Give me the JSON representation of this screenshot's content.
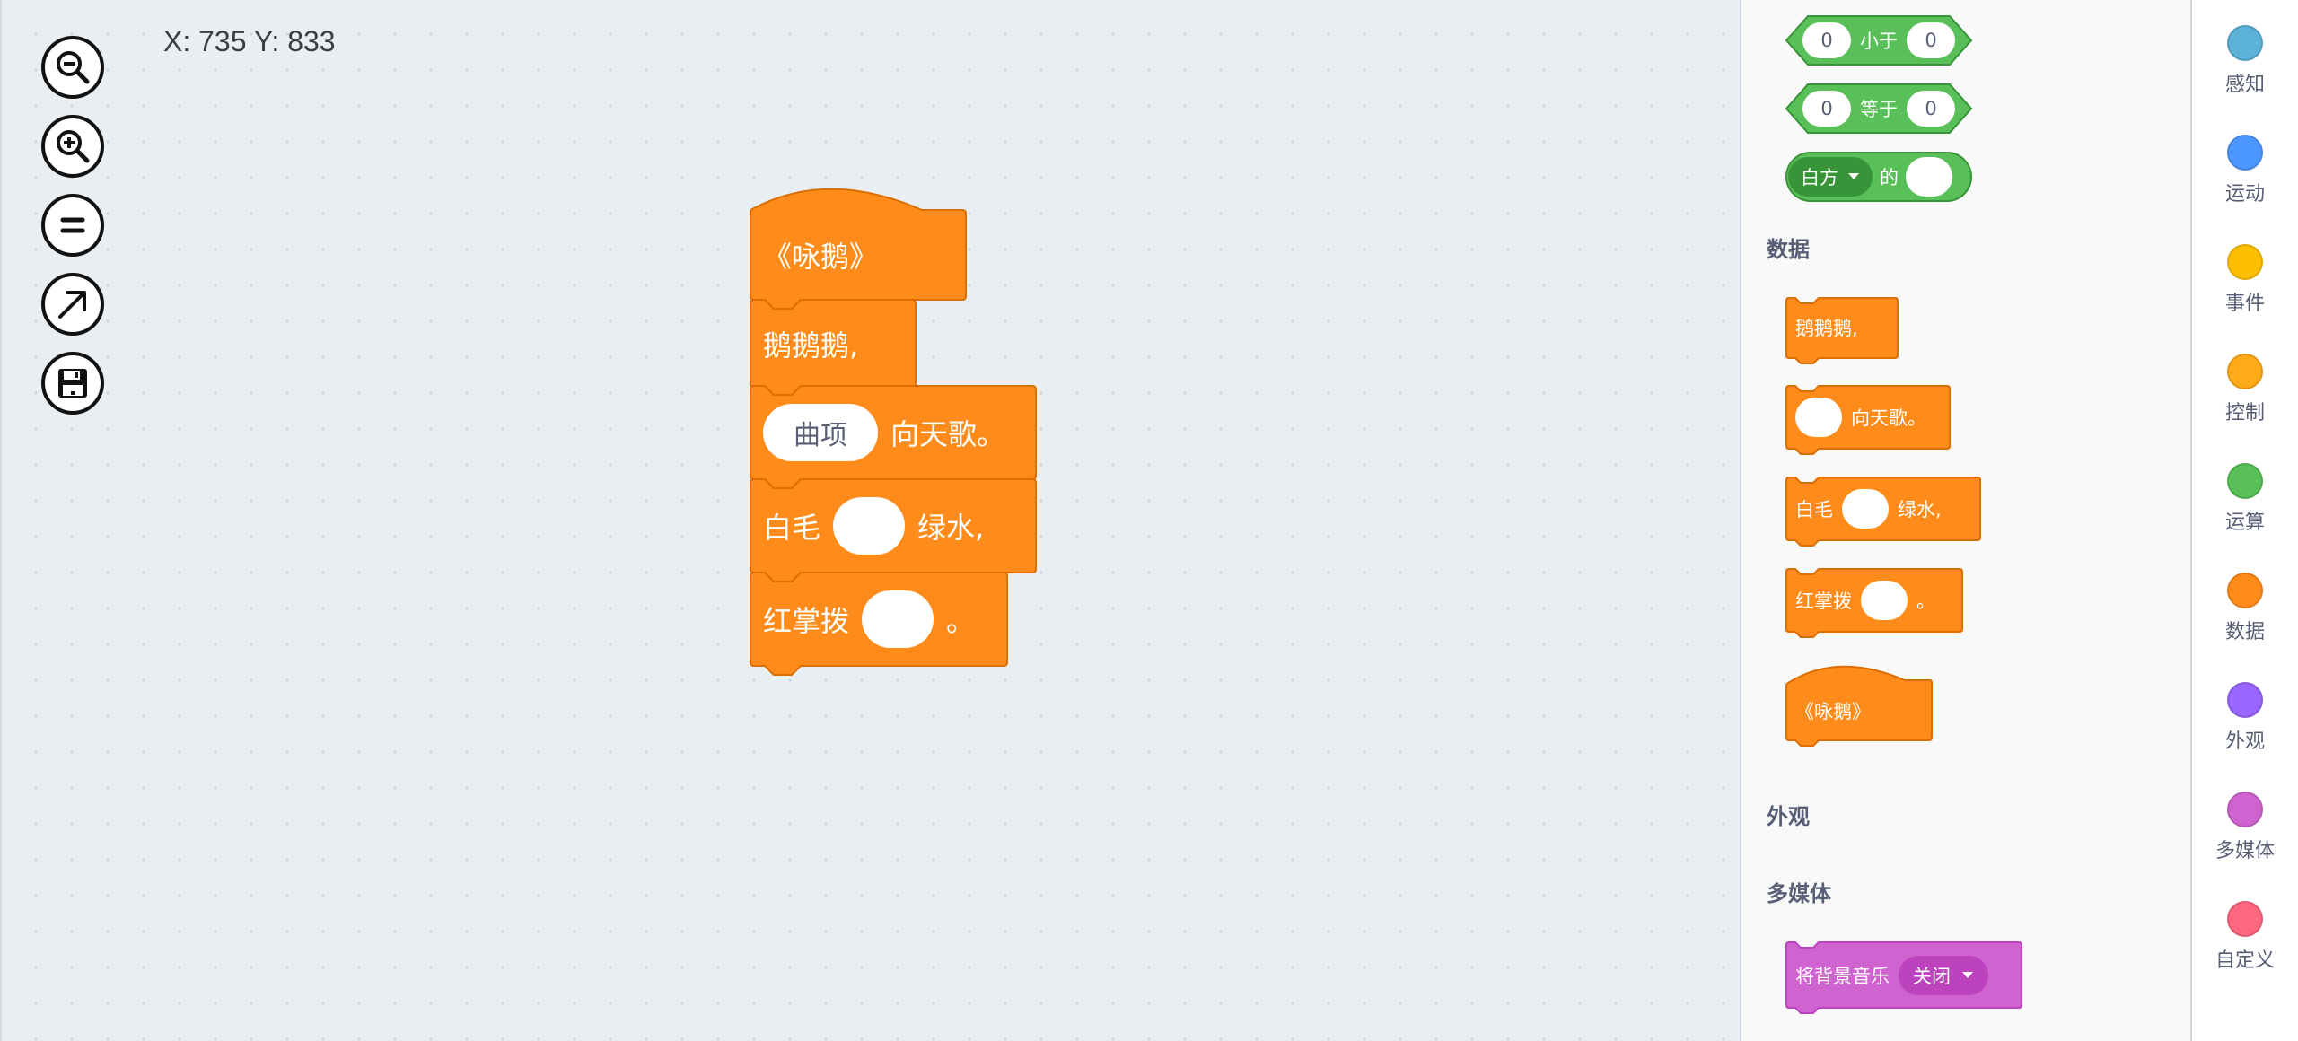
{
  "workspace": {
    "coords": "X: 735 Y: 833",
    "tools": [
      {
        "name": "zoom-out"
      },
      {
        "name": "zoom-in"
      },
      {
        "name": "reset-zoom"
      },
      {
        "name": "expand"
      },
      {
        "name": "save"
      }
    ],
    "script": {
      "hat": "《咏鹅》",
      "line1": "鹅鹅鹅,",
      "line2_slot": "曲项",
      "line2": "向天歌。",
      "line3_a": "白毛",
      "line3_b": "绿水,",
      "line4_a": "红掌拨",
      "line4_b": "。"
    }
  },
  "palette": {
    "operators": [
      {
        "left": "0",
        "op": "小于",
        "right": "0"
      },
      {
        "left": "0",
        "op": "等于",
        "right": "0"
      }
    ],
    "of_block": {
      "dropdown": "白方",
      "text": "的"
    },
    "headings": {
      "data": "数据",
      "looks": "外观",
      "media": "多媒体"
    },
    "data_blocks": {
      "b1": "鹅鹅鹅,",
      "b2": "向天歌。",
      "b3_a": "白毛",
      "b3_b": "绿水,",
      "b4_a": "红掌拨",
      "b4_b": "。",
      "hat": "《咏鹅》"
    },
    "media_block": {
      "text": "将背景音乐",
      "dropdown": "关闭"
    }
  },
  "categories": [
    {
      "label": "感知",
      "color": "#5cb1d6"
    },
    {
      "label": "运动",
      "color": "#4c97ff"
    },
    {
      "label": "事件",
      "color": "#ffbf00"
    },
    {
      "label": "控制",
      "color": "#ffab19"
    },
    {
      "label": "运算",
      "color": "#59c059"
    },
    {
      "label": "数据",
      "color": "#ff8c1a"
    },
    {
      "label": "外观",
      "color": "#9966ff"
    },
    {
      "label": "多媒体",
      "color": "#cf63cf"
    },
    {
      "label": "自定义",
      "color": "#ff6680"
    }
  ]
}
